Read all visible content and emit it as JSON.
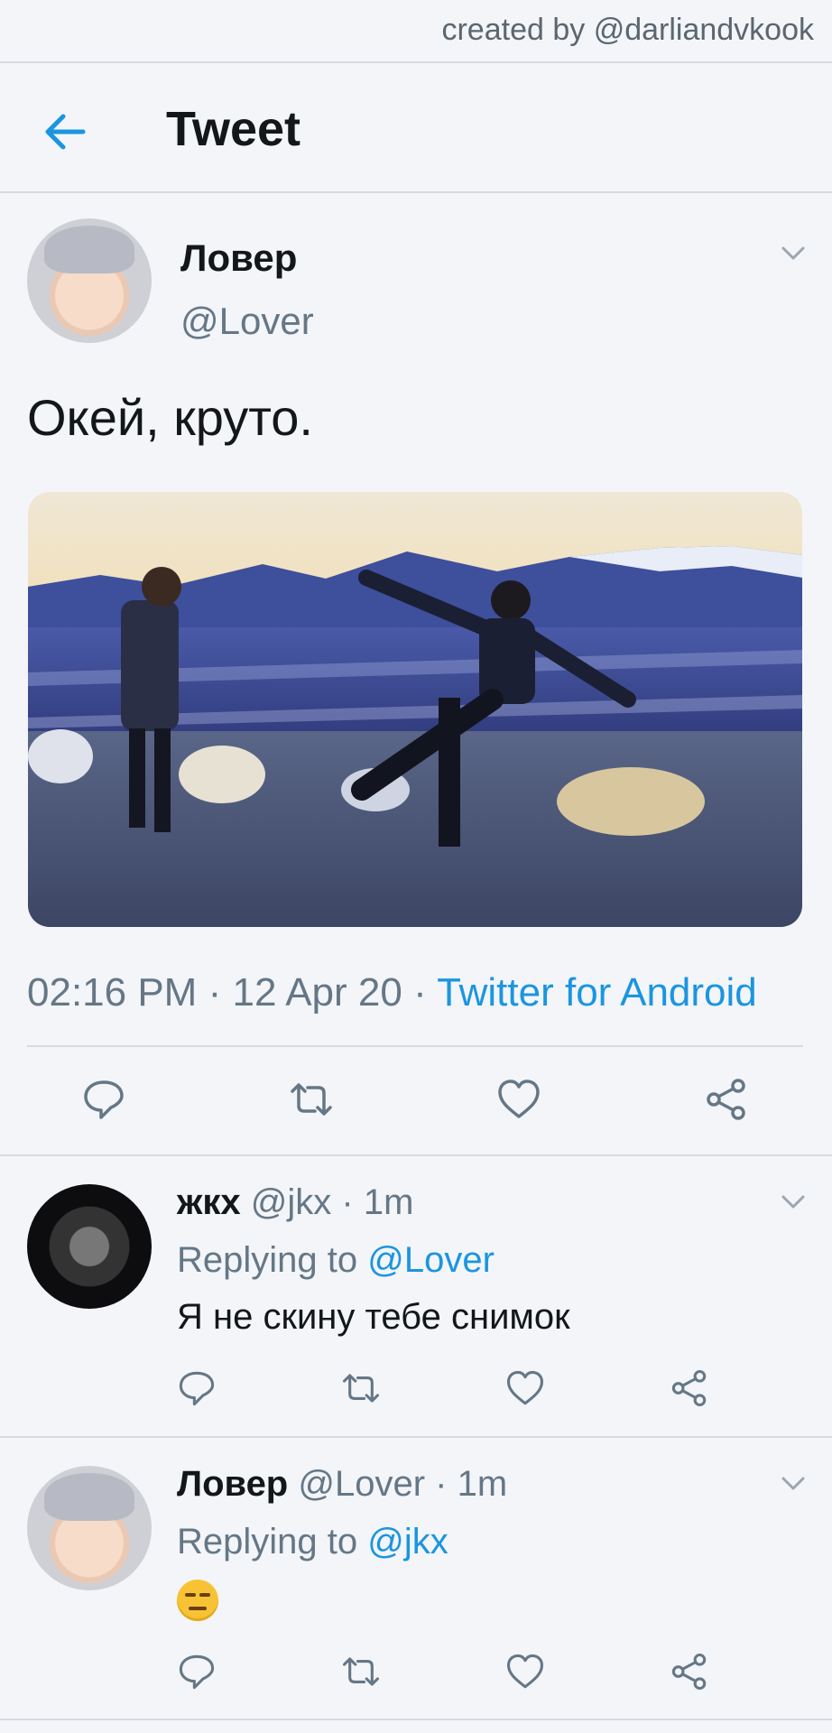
{
  "watermark": "created by @darliandvkook",
  "header": {
    "title": "Tweet"
  },
  "tweet": {
    "author_name": "Ловер",
    "author_handle": "@Lover",
    "text": "Окей, круто.",
    "time": "02:16 PM",
    "date": "12 Apr 20",
    "separator": "·",
    "source": "Twitter for Android"
  },
  "replies": [
    {
      "name": "жкх",
      "handle": "@jkx",
      "age": "1m",
      "replying_prefix": "Replying to",
      "replying_to": "@Lover",
      "text": "Я не скину тебе снимок"
    },
    {
      "name": "Ловер",
      "handle": "@Lover",
      "age": "1m",
      "replying_prefix": "Replying to",
      "replying_to": "@jkx",
      "emoji": "expressionless-face"
    }
  ],
  "colors": {
    "accent": "#1b95e0",
    "secondary_text": "#657786",
    "background": "#f3f5f8"
  },
  "icons": [
    "back-arrow-icon",
    "chevron-down-icon",
    "reply-icon",
    "retweet-icon",
    "like-icon",
    "share-icon"
  ]
}
